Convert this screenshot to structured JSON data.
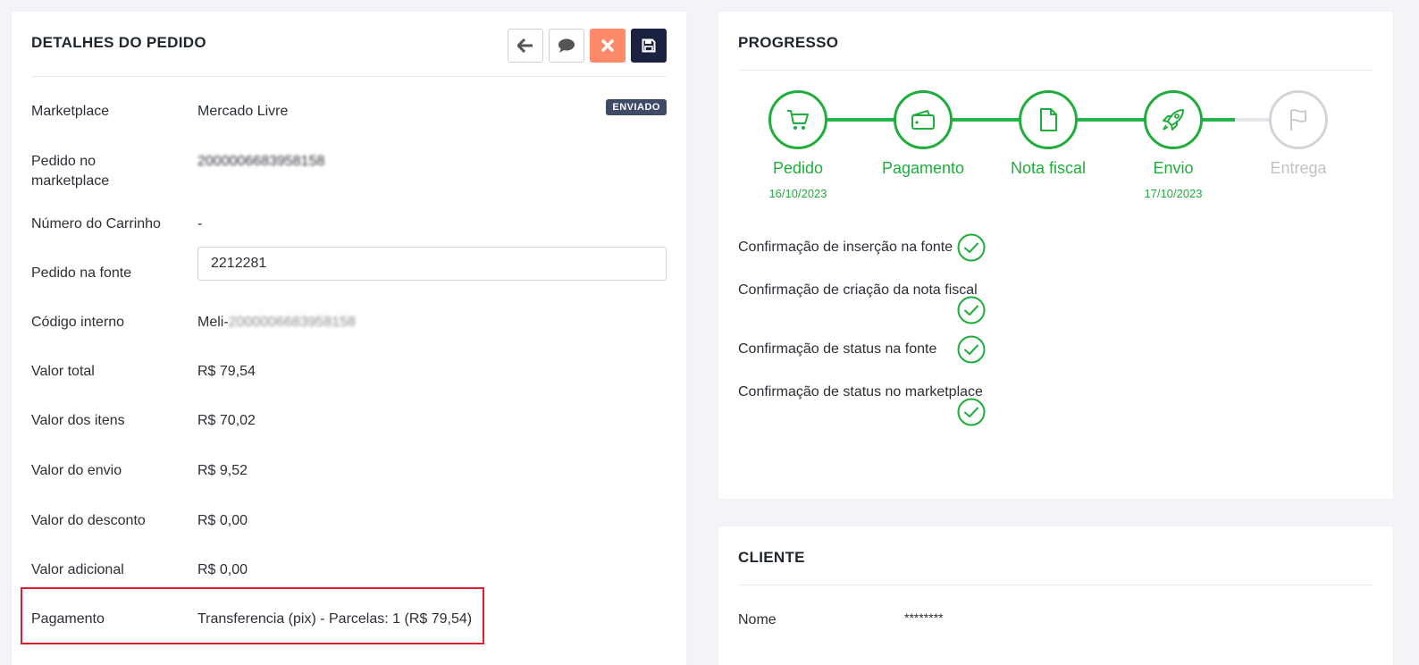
{
  "order": {
    "title": "DETALHES DO PEDIDO",
    "status_badge": "ENVIADO",
    "fields": [
      {
        "label": "Marketplace",
        "value": "Mercado Livre"
      },
      {
        "label": "Pedido no marketplace",
        "value": "2000006683958158"
      },
      {
        "label": "Número do Carrinho",
        "value": "-"
      },
      {
        "label": "Pedido na fonte",
        "value": "2212281"
      },
      {
        "label": "Código interno",
        "value_prefix": "Meli-",
        "value": "2000006683958158"
      },
      {
        "label": "Valor total",
        "value": "R$ 79,54"
      },
      {
        "label": "Valor dos itens",
        "value": "R$ 70,02"
      },
      {
        "label": "Valor do envio",
        "value": "R$ 9,52"
      },
      {
        "label": "Valor do desconto",
        "value": "R$ 0,00"
      },
      {
        "label": "Valor adicional",
        "value": "R$ 0,00"
      },
      {
        "label": "Pagamento",
        "value": "Transferencia (pix) - Parcelas: 1 (R$ 79,54)"
      }
    ]
  },
  "progress": {
    "title": "PROGRESSO",
    "steps": [
      {
        "name": "Pedido",
        "date": "16/10/2023",
        "done": true,
        "icon": "cart-icon"
      },
      {
        "name": "Pagamento",
        "date": "",
        "done": true,
        "icon": "wallet-icon"
      },
      {
        "name": "Nota fiscal",
        "date": "",
        "done": true,
        "icon": "document-icon"
      },
      {
        "name": "Envio",
        "date": "17/10/2023",
        "done": true,
        "icon": "rocket-icon"
      },
      {
        "name": "Entrega",
        "date": "",
        "done": false,
        "icon": "flag-icon"
      }
    ],
    "confirmations": [
      "Confirmação de inserção na fonte",
      "Confirmação de criação da nota fiscal",
      "Confirmação de status na fonte",
      "Confirmação de status no marketplace"
    ]
  },
  "client": {
    "title": "CLIENTE",
    "name_label": "Nome",
    "name_value": "********"
  },
  "colors": {
    "accent_green": "#1fae3b",
    "cancel": "#ff8a6b",
    "save": "#1b2140",
    "highlight": "#e01e2c"
  }
}
